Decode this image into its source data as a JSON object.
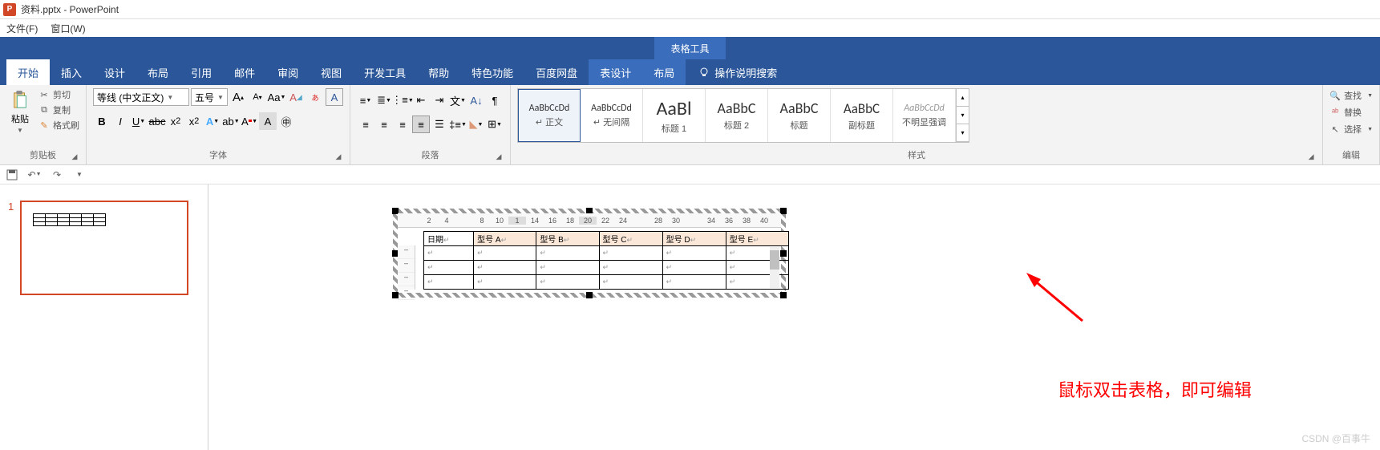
{
  "titlebar": {
    "app_icon_letter": "P",
    "title": "资料.pptx - PowerPoint"
  },
  "topmenu": {
    "file": "文件(F)",
    "window": "窗口(W)"
  },
  "context_tab": "表格工具",
  "tabs": {
    "items": [
      "开始",
      "插入",
      "设计",
      "布局",
      "引用",
      "邮件",
      "审阅",
      "视图",
      "开发工具",
      "帮助",
      "特色功能",
      "百度网盘",
      "表设计",
      "布局"
    ],
    "active_index": 0,
    "tellme": "操作说明搜索"
  },
  "clipboard": {
    "paste": "粘贴",
    "cut": "剪切",
    "copy": "复制",
    "format_painter": "格式刷",
    "label": "剪贴板"
  },
  "font": {
    "family": "等线 (中文正文)",
    "size": "五号",
    "label": "字体"
  },
  "paragraph": {
    "label": "段落"
  },
  "styles": {
    "label": "样式",
    "items": [
      {
        "preview": "AaBbCcDd",
        "name": "↵ 正文",
        "size": "12px"
      },
      {
        "preview": "AaBbCcDd",
        "name": "↵ 无间隔",
        "size": "12px"
      },
      {
        "preview": "AaBl",
        "name": "标题 1",
        "size": "24px"
      },
      {
        "preview": "AaBbC",
        "name": "标题 2",
        "size": "18px"
      },
      {
        "preview": "AaBbC",
        "name": "标题",
        "size": "18px"
      },
      {
        "preview": "AaBbC",
        "name": "副标题",
        "size": "17px"
      },
      {
        "preview": "AaBbCcDd",
        "name": "不明显强调",
        "size": "12px"
      }
    ]
  },
  "editing": {
    "find": "查找",
    "replace": "替换",
    "select": "选择",
    "label": "编辑"
  },
  "ruler_ticks": [
    "2",
    "4",
    "",
    "8",
    "10",
    "1",
    "14",
    "16",
    "18",
    "20",
    "22",
    "24",
    "",
    "28",
    "30",
    "",
    "34",
    "36",
    "38",
    "40"
  ],
  "ruler_shade_idx": [
    2,
    5,
    9,
    12,
    15
  ],
  "table": {
    "headers": [
      "日期↵",
      "型号 A↵",
      "型号 B↵",
      "型号 C↵",
      "型号 D↵",
      "型号 E↵"
    ],
    "rows": 3,
    "cols": 6
  },
  "thumb": {
    "number": "1"
  },
  "annotation_text": "鼠标双击表格，即可编辑",
  "watermark": "CSDN @百事牛"
}
